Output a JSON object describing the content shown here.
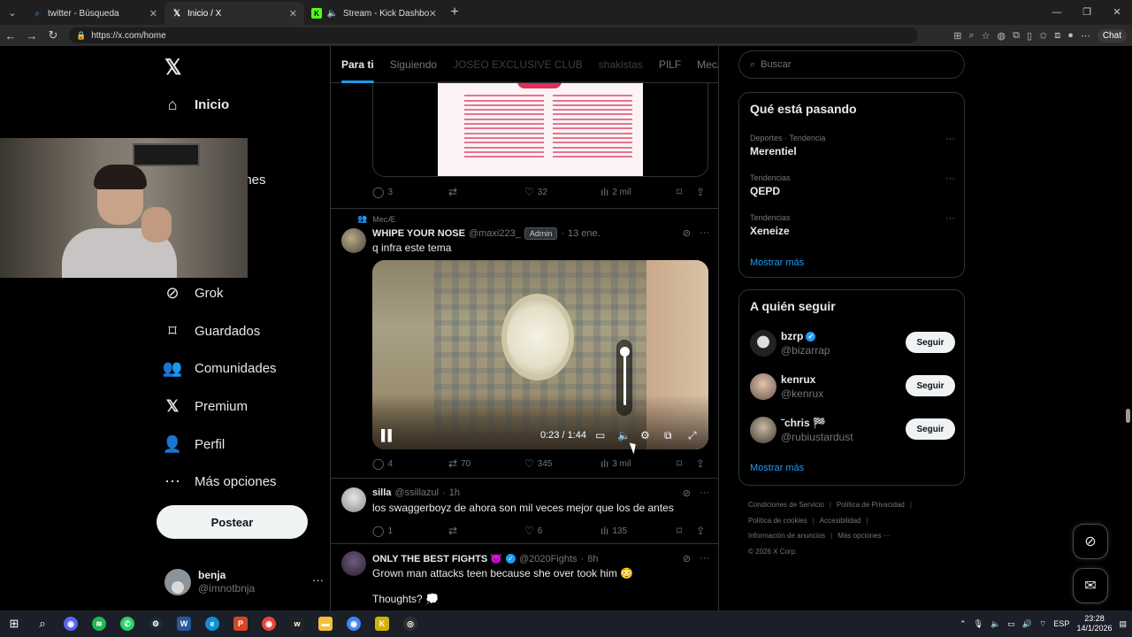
{
  "browser": {
    "tabs": [
      {
        "label": "twitter - Búsqueda",
        "icon": "search-icon",
        "active": false
      },
      {
        "label": "Inicio / X",
        "icon": "x-icon",
        "active": true
      },
      {
        "label": "Stream - Kick Dashboard",
        "icon": "kick-icon",
        "active": false
      }
    ],
    "url": "https://x.com/home",
    "chat_label": "Chat"
  },
  "nav": {
    "items": [
      {
        "label": "Inicio",
        "icon": "home-icon"
      },
      {
        "label": "Grok",
        "icon": "grok-icon"
      },
      {
        "label": "Guardados",
        "icon": "bookmark-icon"
      },
      {
        "label": "Comunidades",
        "icon": "communities-icon"
      },
      {
        "label": "Premium",
        "icon": "x-premium-icon"
      },
      {
        "label": "Perfil",
        "icon": "profile-icon"
      },
      {
        "label": "Más opciones",
        "icon": "more-options-icon"
      }
    ],
    "partial_label": "ones",
    "post_button": "Postear",
    "account": {
      "name": "benja",
      "handle": "@imnotbnja"
    }
  },
  "timeline": {
    "tabs": [
      "Para ti",
      "Siguiendo",
      "JOSEO EXCLUSIVE CLUB",
      "shakistas",
      "PILF",
      "MecÆ"
    ],
    "active_tab": "Para ti",
    "post1_stats": {
      "replies": "3",
      "reposts": "",
      "likes": "32",
      "views": "2 mil"
    },
    "post2": {
      "community": "MecÆ",
      "name": "WHIPE YOUR NOSE",
      "handle": "@maxi223_",
      "badge": "Admin",
      "time": "13 ene.",
      "text": "q infra este tema",
      "video_time": "0:23 / 1:44",
      "stats": {
        "replies": "4",
        "reposts": "70",
        "likes": "345",
        "views": "3 mil"
      }
    },
    "post3": {
      "name": "silla",
      "handle": "@ssillazul",
      "time": "1h",
      "text": "los swaggerboyz de ahora son mil veces mejor que los de antes",
      "stats": {
        "replies": "1",
        "reposts": "",
        "likes": "6",
        "views": "135"
      }
    },
    "post4": {
      "name": "ONLY THE BEST FIGHTS 😈",
      "handle": "@2020Fights",
      "time": "8h",
      "text": "Grown man attacks teen because she over took him 😳",
      "text2": "Thoughts? 💭"
    }
  },
  "sidebar": {
    "search_placeholder": "Buscar",
    "trends_title": "Qué está pasando",
    "trends": [
      {
        "category": "Deportes · Tendencia",
        "topic": "Merentiel"
      },
      {
        "category": "Tendencias",
        "topic": "QEPD"
      },
      {
        "category": "Tendencias",
        "topic": "Xeneize"
      }
    ],
    "show_more": "Mostrar más",
    "follow_title": "A quién seguir",
    "follow": [
      {
        "name": "bzrp",
        "handle": "@bizarrap",
        "verified": true
      },
      {
        "name": "kenrux",
        "handle": "@kenrux",
        "verified": false
      },
      {
        "name": "˜chris 🏁",
        "handle": "@rubiustardust",
        "verified": false
      }
    ],
    "follow_button": "Seguir",
    "footer": [
      "Condiciones de Servicio",
      "Política de Privacidad",
      "Política de cookies",
      "Accesibilidad",
      "Información de anuncios",
      "Más opciones ···",
      "© 2026 X Corp."
    ]
  },
  "taskbar": {
    "lang": "ESP",
    "time": "23:28",
    "date": "14/1/2026"
  },
  "colors": {
    "accent": "#1d9bf0",
    "background": "#000000",
    "border": "#2f3336",
    "muted": "#71767b"
  }
}
